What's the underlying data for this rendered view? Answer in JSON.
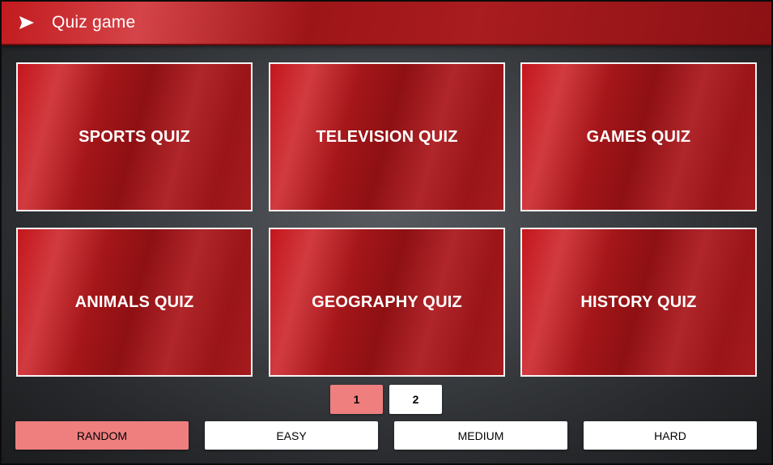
{
  "header": {
    "title": "Quiz game",
    "icon": "send-icon"
  },
  "quizzes": [
    {
      "label": "SPORTS QUIZ"
    },
    {
      "label": "TELEVISION QUIZ"
    },
    {
      "label": "GAMES QUIZ"
    },
    {
      "label": "ANIMALS QUIZ"
    },
    {
      "label": "GEOGRAPHY QUIZ"
    },
    {
      "label": "HISTORY QUIZ"
    }
  ],
  "pagination": {
    "pages": [
      "1",
      "2"
    ],
    "current": "1"
  },
  "difficulty": {
    "options": [
      "RANDOM",
      "EASY",
      "MEDIUM",
      "HARD"
    ],
    "selected": "RANDOM"
  },
  "colors": {
    "header_red": "#b0191d",
    "tile_red": "#a41619",
    "selected_pink": "#ef7f7f",
    "background": "#3d4044"
  }
}
